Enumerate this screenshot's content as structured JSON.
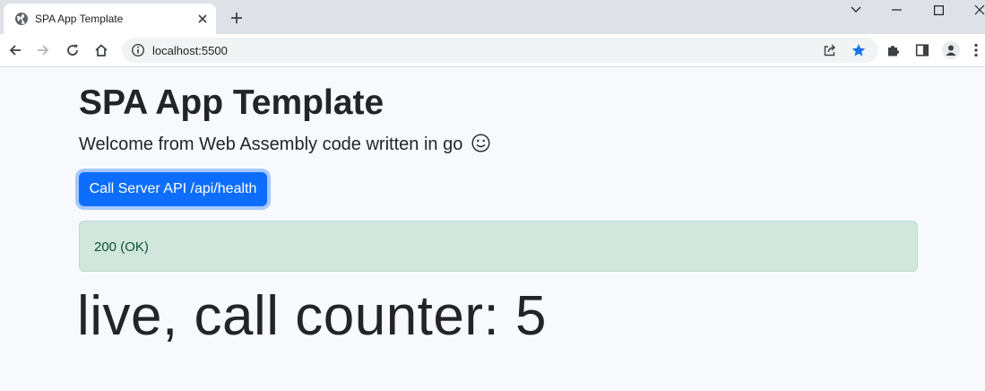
{
  "browser": {
    "tab": {
      "title": "SPA App Template",
      "favicon_icon": "globe-icon",
      "close_icon": "close-icon"
    },
    "new_tab_icon": "plus-icon",
    "window_controls": [
      "chevron-down-icon",
      "minimize-icon",
      "maximize-icon",
      "close-icon"
    ],
    "toolbar": {
      "back_icon": "arrow-left-icon",
      "forward_icon": "arrow-right-icon",
      "reload_icon": "reload-icon",
      "home_icon": "home-icon",
      "url": "localhost:5500",
      "site_info_icon": "info-icon",
      "share_icon": "share-icon",
      "bookmark_icon": "star-icon",
      "extensions_icon": "puzzle-icon",
      "side_panel_icon": "side-panel-icon",
      "profile_icon": "avatar-icon",
      "menu_icon": "kebab-menu-icon"
    },
    "colors": {
      "tabstrip": "#dee1e6",
      "accent_star": "#1a73e8"
    }
  },
  "page": {
    "title": "SPA App Template",
    "lead": "Welcome from Web Assembly code written in go",
    "lead_icon": "smiley-icon",
    "api_button_label": "Call Server API /api/health",
    "alert_text": "200 (OK)",
    "counter_text": "live, call counter: 5",
    "colors": {
      "background": "#f8f9fd",
      "button": "#0d6efd",
      "alert_bg": "#d1e7dd",
      "alert_text": "#0f5132"
    }
  }
}
